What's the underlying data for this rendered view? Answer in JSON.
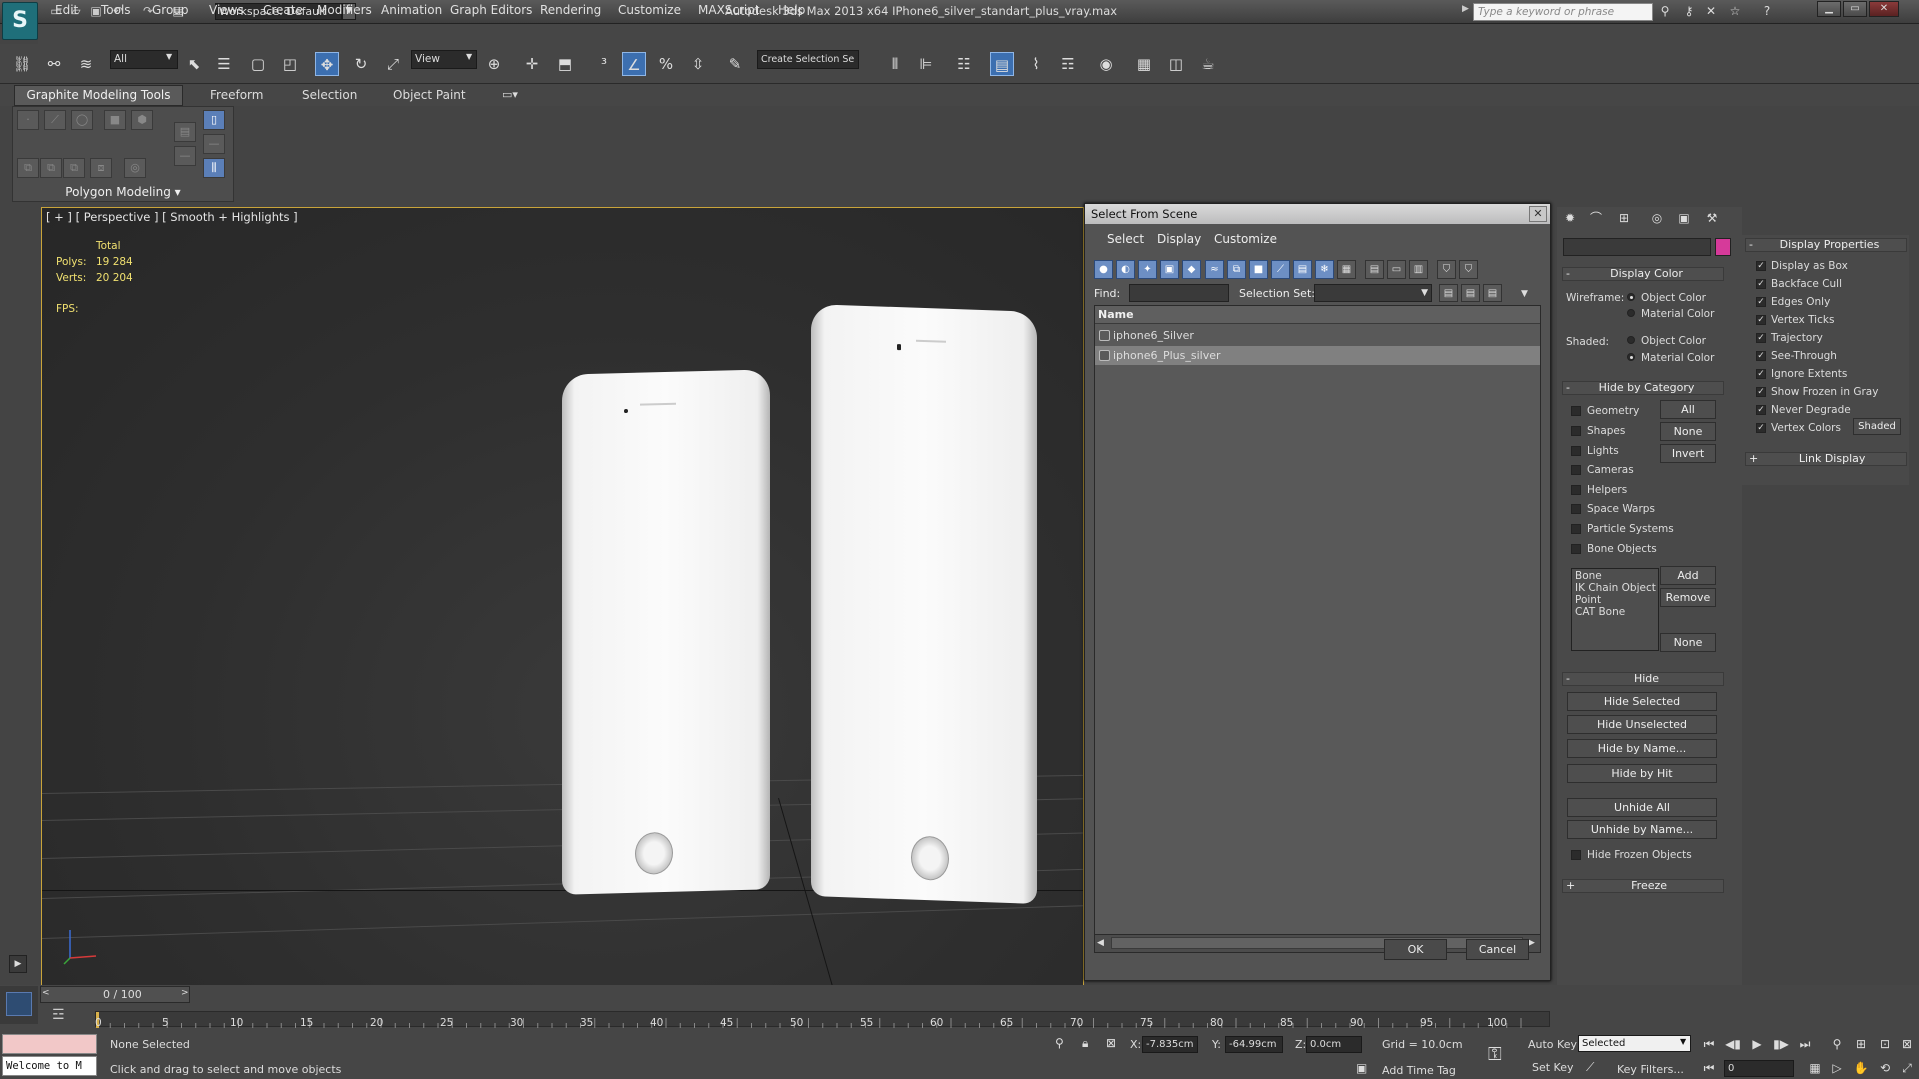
{
  "app": {
    "title": "Autodesk 3ds Max  2013 x64     IPhone6_silver_standart_plus_vray.max",
    "logo": "S",
    "workspace": "Workspace: Default",
    "search_placeholder": "Type a keyword or phrase"
  },
  "menu": [
    "Edit",
    "Tools",
    "Group",
    "Views",
    "Create",
    "Modifiers",
    "Animation",
    "Graph Editors",
    "Rendering",
    "Customize",
    "MAXScript",
    "Help"
  ],
  "main_toolbar": {
    "filter": "All",
    "ref_coord": "View",
    "selection_set": "Create Selection Se"
  },
  "ribbon": {
    "tabs": [
      "Graphite Modeling Tools",
      "Freeform",
      "Selection",
      "Object Paint"
    ],
    "panel_label": "Polygon Modeling"
  },
  "viewport": {
    "label": "[ + ] [ Perspective ] [ Smooth + Highlights ]",
    "stats": {
      "total": "Total",
      "polys_label": "Polys:",
      "polys": "19 284",
      "verts_label": "Verts:",
      "verts": "20 204",
      "fps_label": "FPS:"
    }
  },
  "dialog": {
    "title": "Select From Scene",
    "menu": [
      "Select",
      "Display",
      "Customize"
    ],
    "find_label": "Find:",
    "selection_set_label": "Selection Set:",
    "column_header": "Name",
    "rows": [
      {
        "name": "iphone6_Silver",
        "selected": false
      },
      {
        "name": "iphone6_Plus_silver",
        "selected": true
      }
    ],
    "ok": "OK",
    "cancel": "Cancel"
  },
  "display_color": {
    "header": "Display Color",
    "wireframe_label": "Wireframe:",
    "shaded_label": "Shaded:",
    "object_color": "Object Color",
    "material_color": "Material Color",
    "swatch_color": "#d63a9a"
  },
  "hide_by_category": {
    "header": "Hide by Category",
    "items": [
      "Geometry",
      "Shapes",
      "Lights",
      "Cameras",
      "Helpers",
      "Space Warps",
      "Particle Systems",
      "Bone Objects"
    ],
    "buttons": [
      "All",
      "None",
      "Invert"
    ],
    "list": [
      "Bone",
      "IK Chain Object",
      "Point",
      "CAT Bone"
    ],
    "list_buttons": [
      "Add",
      "Remove",
      "None"
    ]
  },
  "hide": {
    "header": "Hide",
    "buttons": [
      "Hide Selected",
      "Hide Unselected",
      "Hide by Name...",
      "Hide by Hit",
      "Unhide All",
      "Unhide by Name..."
    ],
    "frozen": "Hide Frozen Objects"
  },
  "freeze": {
    "header": "Freeze"
  },
  "display_properties": {
    "header": "Display Properties",
    "items": [
      "Display as Box",
      "Backface Cull",
      "Edges Only",
      "Vertex Ticks",
      "Trajectory",
      "See-Through",
      "Ignore Extents",
      "Show Frozen in Gray",
      "Never Degrade",
      "Vertex Colors"
    ],
    "shaded_button": "Shaded",
    "link_display": "Link Display"
  },
  "timeline": {
    "slider": "0 / 100",
    "ticks": [
      "0",
      "5",
      "10",
      "15",
      "20",
      "25",
      "30",
      "35",
      "40",
      "45",
      "50",
      "55",
      "60",
      "65",
      "70",
      "75",
      "80",
      "85",
      "90",
      "95",
      "100"
    ]
  },
  "status": {
    "script_listener": "Welcome to M",
    "selection": "None Selected",
    "prompt": "Click and drag to select and move objects",
    "x_label": "X:",
    "x": "-7.835cm",
    "y_label": "Y:",
    "y": "-64.99cm",
    "z_label": "Z:",
    "z": "0.0cm",
    "grid": "Grid = 10.0cm",
    "add_time_tag": "Add Time Tag",
    "auto_key": "Auto Key",
    "set_key": "Set Key",
    "key_mode": "Selected",
    "key_filters": "Key Filters...",
    "frame": "0"
  }
}
